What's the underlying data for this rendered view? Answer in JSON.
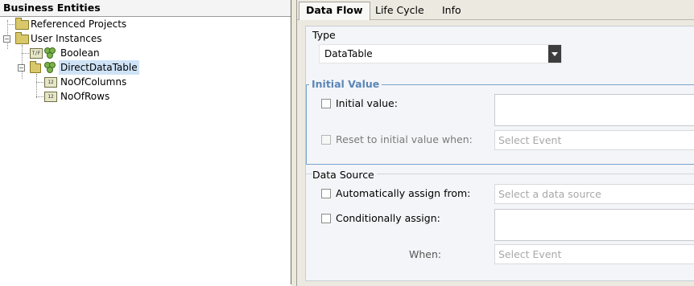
{
  "left_panel": {
    "title": "Business Entities",
    "tree": [
      {
        "label": "Referenced Projects",
        "icon": "folder-icon"
      },
      {
        "label": "User Instances",
        "icon": "folder-open-icon"
      },
      {
        "label": "Boolean",
        "type_badge": "T/F",
        "icon": "entity-icon"
      },
      {
        "label": "DirectDataTable",
        "icon": "entity-icon",
        "selected": true
      },
      {
        "label": "NoOfColumns",
        "type_badge": "12",
        "icon": "number-field-icon"
      },
      {
        "label": "NoOfRows",
        "type_badge": "12",
        "icon": "number-field-icon"
      }
    ]
  },
  "tabs": [
    {
      "label": "Data Flow",
      "active": true
    },
    {
      "label": "Life Cycle",
      "active": false
    },
    {
      "label": "Info",
      "active": false
    }
  ],
  "type_section": {
    "title": "Type",
    "selected_value": "DataTable"
  },
  "initial_value": {
    "title": "Initial Value",
    "initial_value_label": "Initial value:",
    "initial_value_input": "",
    "reset_label": "Reset to initial value when:",
    "reset_placeholder": "Select Event"
  },
  "data_source": {
    "title": "Data Source",
    "auto_assign_label": "Automatically assign from:",
    "auto_assign_placeholder": "Select a data source",
    "conditional_label": "Conditionally assign:",
    "conditional_input": "",
    "when_label": "When:",
    "when_placeholder": "Select Event"
  },
  "colors": {
    "accent_blue": "#5a86b8",
    "selection": "#cfe3f7"
  }
}
